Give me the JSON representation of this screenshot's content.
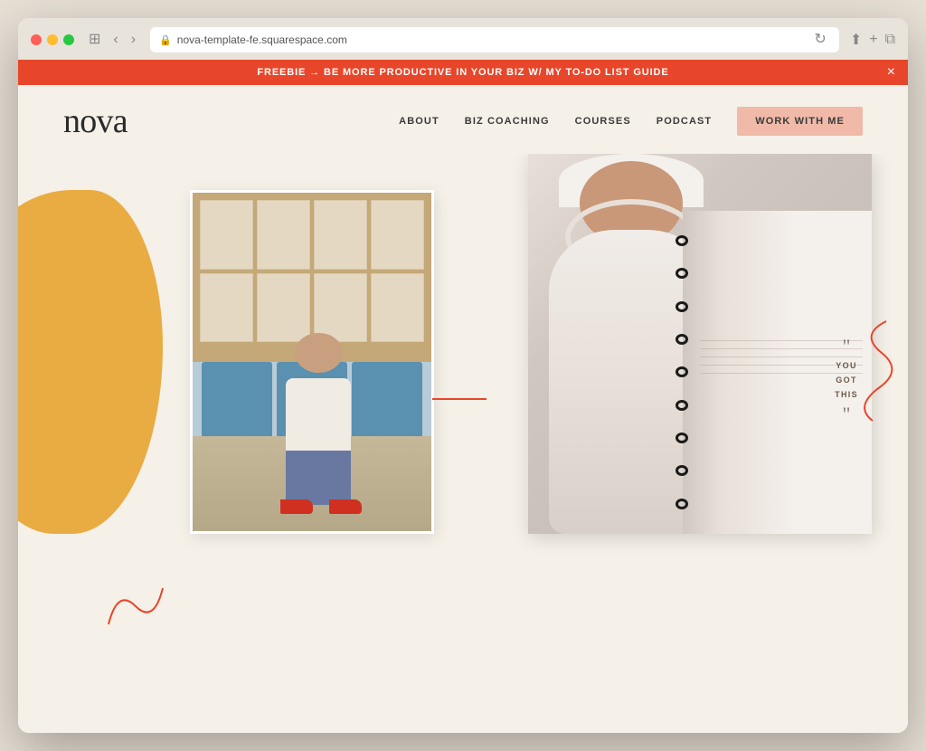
{
  "browser": {
    "url": "nova-template-fe.squarespace.com",
    "lock_icon": "🔒",
    "refresh_icon": "↻",
    "back_icon": "‹",
    "forward_icon": "›",
    "sidebar_icon": "⊞",
    "share_icon": "⬆",
    "new_tab_icon": "+",
    "copy_icon": "⧉"
  },
  "banner": {
    "text": "FREEBIE → BE MORE PRODUCTIVE IN YOUR BIZ W/ MY TO-DO LIST GUIDE",
    "close_label": "×"
  },
  "header": {
    "logo": "nova",
    "nav": {
      "about": "ABOUT",
      "biz_coaching": "BIZ COACHING",
      "courses": "COURSES",
      "podcast": "PODCAST",
      "cta": "WORK WITH ME"
    }
  },
  "main": {
    "quote": {
      "open_mark": "\"",
      "line1": "YOU",
      "line2": "GOT",
      "line3": "THIS",
      "close_mark": "\""
    }
  },
  "colors": {
    "banner_bg": "#e8462a",
    "cta_bg": "#f0b9a8",
    "blob_orange": "#e8a83a",
    "red_accent": "#e8462a",
    "page_bg": "#f5f0e8"
  }
}
